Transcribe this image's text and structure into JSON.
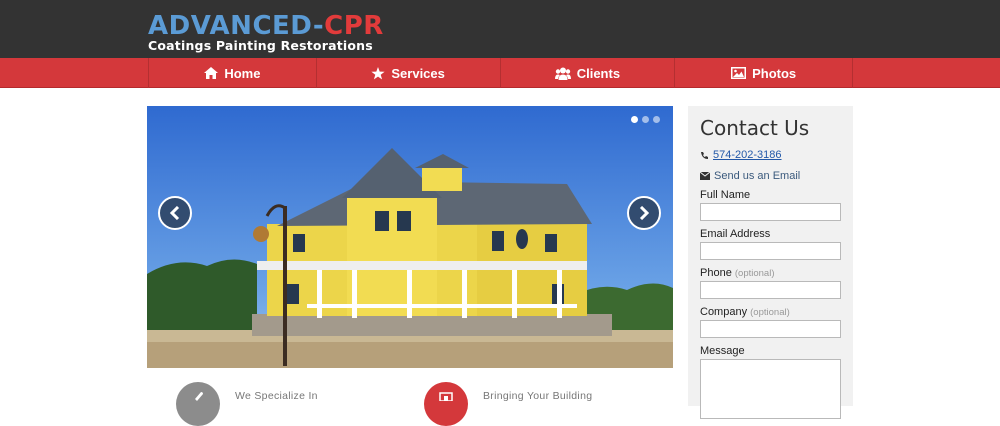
{
  "header": {
    "logo_part1": "ADVANCED-",
    "logo_part2": "CPR",
    "tagline": "Coatings Painting Restorations"
  },
  "nav": {
    "home": "Home",
    "services": "Services",
    "clients": "Clients",
    "photos": "Photos"
  },
  "slider": {
    "image": "house-icon",
    "dots_count": 3,
    "active_dot": 1
  },
  "features": {
    "f1_text": "We Specialize In",
    "f2_text": "Bringing Your Building"
  },
  "contact": {
    "title": "Contact Us",
    "phone": "574-202-3186",
    "email_link": "Send us an Email",
    "full_name_label": "Full Name",
    "email_label": "Email Address",
    "phone_label": "Phone",
    "company_label": "Company",
    "optional_text": "(optional)",
    "message_label": "Message"
  },
  "colors": {
    "header_bg": "#333333",
    "nav_red": "#d4383b",
    "logo_blue": "#5b9bd5",
    "logo_red": "#e23b3b",
    "panel_bg": "#f1f1f1"
  }
}
